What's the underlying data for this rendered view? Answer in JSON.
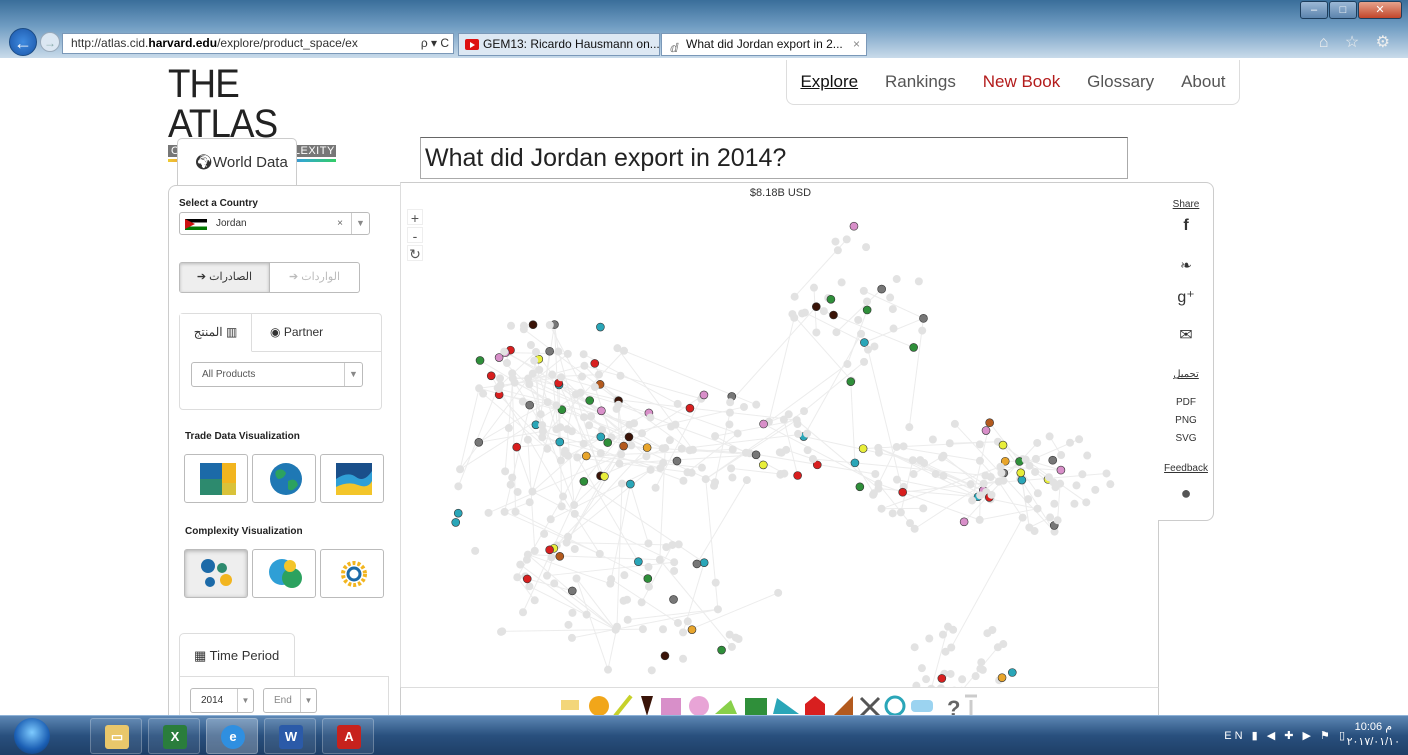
{
  "browser": {
    "url_plain": "http://atlas.cid.",
    "url_bold": "harvard.edu",
    "url_rest": "/explore/product_space/ex",
    "url_ctl": "ρ ▾ C",
    "tab1": "GEM13: Ricardo Hausmann on...",
    "tab2": "What did Jordan export in 2...",
    "tab_close": "×",
    "tool_icons": "⌂ ☆ ⚙"
  },
  "logo": {
    "title": "THE ATLAS",
    "subtitle": "OF ECONOMIC COMPLEXITY"
  },
  "nav": {
    "items": [
      "Explore",
      "Rankings",
      "New Book",
      "Glossary",
      "About"
    ],
    "active": "Explore",
    "highlight": "New Book"
  },
  "question": "What did Jordan export in 2014?",
  "sidebar": {
    "world_data_tab": "World Data",
    "select_country_label": "Select a Country",
    "country": "Jordan",
    "clear": "×",
    "exports_label": "الصادرات",
    "imports_label": "الواردات",
    "product_tab": "المنتج",
    "partner_tab": "Partner",
    "product_select": "All Products",
    "trade_viz_label": "Trade Data Visualization",
    "complexity_viz_label": "Complexity Visualization",
    "time_period_tab": "Time Period",
    "year": "2014",
    "end": "End"
  },
  "viz": {
    "total": "$8.18B USD",
    "zoom_in": "+",
    "zoom_out": "-",
    "reset": "↻"
  },
  "share": {
    "title": "Share",
    "download": "تحميل",
    "formats": [
      "PDF",
      "PNG",
      "SVG"
    ],
    "feedback": "Feedback"
  },
  "taskbar": {
    "lang": "EN",
    "time": "10:06 م",
    "date": "٢٠١٧/٠١/١٠"
  },
  "colors": {
    "node_grey": "#e2e2e2",
    "pink": "#d88fc9",
    "teal": "#2aa6b8",
    "green": "#2f8f3a",
    "dark_brown": "#3a1408",
    "yellow": "#e8ee3a",
    "orange": "#e8a52c",
    "red": "#d81f1f",
    "brown": "#b35a1e",
    "grey": "#777777",
    "nav_red": "#b31b1b"
  }
}
